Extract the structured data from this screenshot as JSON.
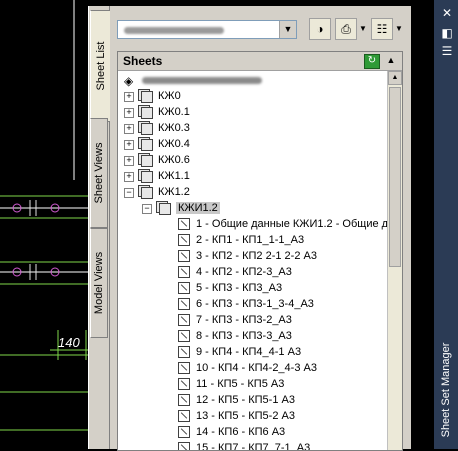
{
  "vertical_tabs": [
    {
      "id": "sheet-list",
      "label": "Sheet List",
      "active": true
    },
    {
      "id": "sheet-views",
      "label": "Sheet Views",
      "active": false
    },
    {
      "id": "model-views",
      "label": "Model Views",
      "active": false
    }
  ],
  "palette_title": "Sheet Set Manager",
  "panel": {
    "title": "Sheets"
  },
  "cad": {
    "dimension": "140"
  },
  "tree": {
    "subsets": [
      "КЖ0",
      "КЖ0.1",
      "КЖ0.3",
      "КЖ0.4",
      "КЖ0.6",
      "КЖ1.1",
      "КЖ1.2"
    ],
    "selected_subset": "КЖИ1.2",
    "sheets": [
      "1 - Общие данные КЖИ1.2 - Общие д",
      "2 - КП1 - КП1_1-1_А3",
      "3 - КП2 - КП2 2-1 2-2  А3",
      "4 - КП2 - КП2-3_А3",
      "5 - КП3 - КП3_А3",
      "6 - КП3 - КП3-1_3-4_А3",
      "7 - КП3 - КП3-2_А3",
      "8 - КП3 - КП3-3_А3",
      "9 - КП4 - КП4_4-1 А3",
      "10 - КП4 - КП4-2_4-3  А3",
      "11 - КП5 - КП5 А3",
      "12 - КП5 - КП5-1  А3",
      "13 - КП5 - КП5-2  А3",
      "14 - КП6 - КП6 А3",
      "15 - КП7 - КП7_7-1_А3"
    ]
  },
  "icons": {
    "close": "close-icon",
    "autohide": "autohide-icon",
    "properties": "properties-icon",
    "refresh": "refresh-icon",
    "publish": "publish-icon",
    "plot": "plot-icon",
    "view": "view-options-icon"
  },
  "colors": {
    "cad_bg": "#000000",
    "palette_bg": "#d4d0c8",
    "title_bar": "#2b3b55",
    "cad_green": "#7fd84a",
    "cad_magenta": "#d25bd2"
  }
}
